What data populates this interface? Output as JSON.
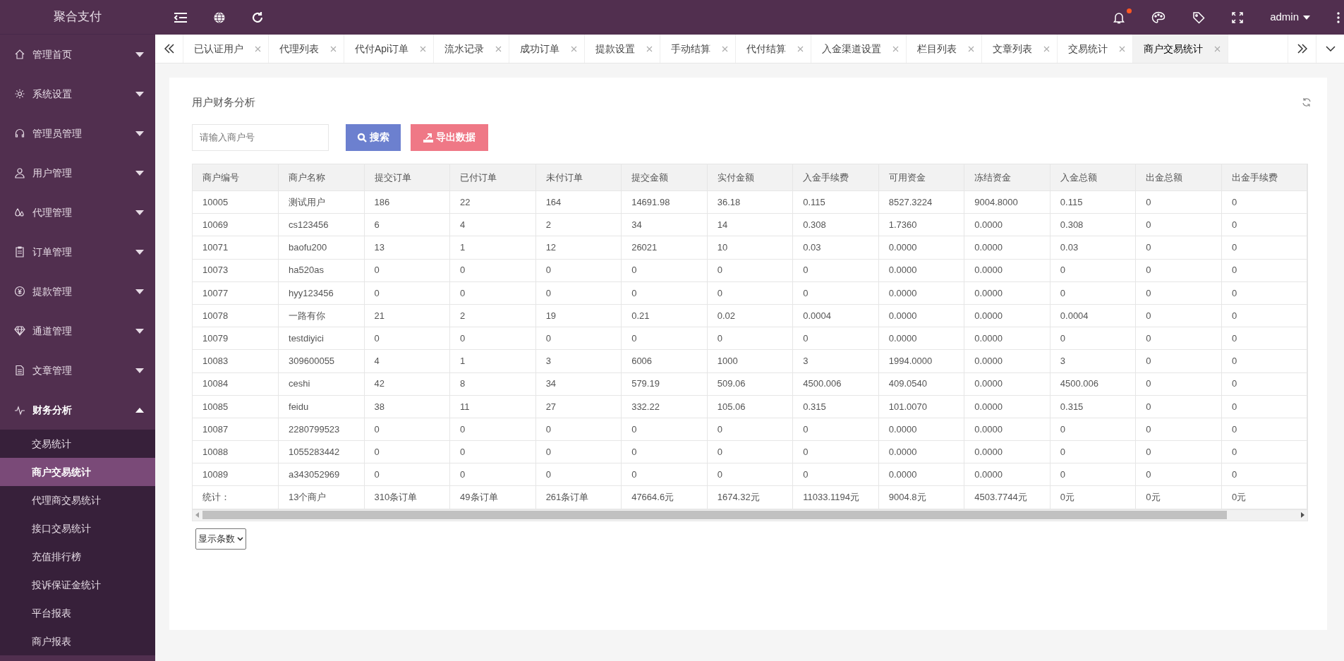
{
  "logo": "聚合支付",
  "user_menu": {
    "label": "admin"
  },
  "notification": {
    "unread": true
  },
  "tabs": [
    {
      "label": "已认证用户",
      "selected": false
    },
    {
      "label": "代理列表",
      "selected": false
    },
    {
      "label": "代付Api订单",
      "selected": false
    },
    {
      "label": "流水记录",
      "selected": false
    },
    {
      "label": "成功订单",
      "selected": false
    },
    {
      "label": "提款设置",
      "selected": false
    },
    {
      "label": "手动结算",
      "selected": false
    },
    {
      "label": "代付结算",
      "selected": false
    },
    {
      "label": "入金渠道设置",
      "selected": false
    },
    {
      "label": "栏目列表",
      "selected": false
    },
    {
      "label": "文章列表",
      "selected": false
    },
    {
      "label": "交易统计",
      "selected": false
    },
    {
      "label": "商户交易统计",
      "selected": true
    }
  ],
  "sidebar": {
    "items": [
      {
        "label": "管理首页",
        "expanded": false
      },
      {
        "label": "系统设置",
        "expanded": false
      },
      {
        "label": "管理员管理",
        "expanded": false
      },
      {
        "label": "用户管理",
        "expanded": false
      },
      {
        "label": "代理管理",
        "expanded": false
      },
      {
        "label": "订单管理",
        "expanded": false
      },
      {
        "label": "提款管理",
        "expanded": false
      },
      {
        "label": "通道管理",
        "expanded": false
      },
      {
        "label": "文章管理",
        "expanded": false
      },
      {
        "label": "财务分析",
        "expanded": true,
        "children": [
          {
            "label": "交易统计",
            "selected": false
          },
          {
            "label": "商户交易统计",
            "selected": true
          },
          {
            "label": "代理商交易统计",
            "selected": false
          },
          {
            "label": "接口交易统计",
            "selected": false
          },
          {
            "label": "充值排行榜",
            "selected": false
          },
          {
            "label": "投诉保证金统计",
            "selected": false
          },
          {
            "label": "平台报表",
            "selected": false
          },
          {
            "label": "商户报表",
            "selected": false
          }
        ]
      }
    ]
  },
  "panel": {
    "title": "用户财务分析",
    "search": {
      "placeholder": "请输入商户号"
    },
    "buttons": [
      {
        "kind": "search",
        "label": "搜索"
      },
      {
        "kind": "export",
        "label": "导出数据"
      }
    ],
    "table": {
      "columns": [
        "商户编号",
        "商户名称",
        "提交订单",
        "已付订单",
        "未付订单",
        "提交金额",
        "实付金额",
        "入金手续费",
        "可用资金",
        "冻结资金",
        "入金总额",
        "出金总额",
        "出金手续费"
      ],
      "rows": [
        [
          "10005",
          "测试用户",
          "186",
          "22",
          "164",
          "14691.98",
          "36.18",
          "0.115",
          "8527.3224",
          "9004.8000",
          "0.115",
          "0",
          "0"
        ],
        [
          "10069",
          "cs123456",
          "6",
          "4",
          "2",
          "34",
          "14",
          "0.308",
          "1.7360",
          "0.0000",
          "0.308",
          "0",
          "0"
        ],
        [
          "10071",
          "baofu200",
          "13",
          "1",
          "12",
          "26021",
          "10",
          "0.03",
          "0.0000",
          "0.0000",
          "0.03",
          "0",
          "0"
        ],
        [
          "10073",
          "ha520as",
          "0",
          "0",
          "0",
          "0",
          "0",
          "0",
          "0.0000",
          "0.0000",
          "0",
          "0",
          "0"
        ],
        [
          "10077",
          "hyy123456",
          "0",
          "0",
          "0",
          "0",
          "0",
          "0",
          "0.0000",
          "0.0000",
          "0",
          "0",
          "0"
        ],
        [
          "10078",
          "一路有你",
          "21",
          "2",
          "19",
          "0.21",
          "0.02",
          "0.0004",
          "0.0000",
          "0.0000",
          "0.0004",
          "0",
          "0"
        ],
        [
          "10079",
          "testdiyici",
          "0",
          "0",
          "0",
          "0",
          "0",
          "0",
          "0.0000",
          "0.0000",
          "0",
          "0",
          "0"
        ],
        [
          "10083",
          "309600055",
          "4",
          "1",
          "3",
          "6006",
          "1000",
          "3",
          "1994.0000",
          "0.0000",
          "3",
          "0",
          "0"
        ],
        [
          "10084",
          "ceshi",
          "42",
          "8",
          "34",
          "579.19",
          "509.06",
          "4500.006",
          "409.0540",
          "0.0000",
          "4500.006",
          "0",
          "0"
        ],
        [
          "10085",
          "feidu",
          "38",
          "11",
          "27",
          "332.22",
          "105.06",
          "0.315",
          "101.0070",
          "0.0000",
          "0.315",
          "0",
          "0"
        ],
        [
          "10087",
          "2280799523",
          "0",
          "0",
          "0",
          "0",
          "0",
          "0",
          "0.0000",
          "0.0000",
          "0",
          "0",
          "0"
        ],
        [
          "10088",
          "1055283442",
          "0",
          "0",
          "0",
          "0",
          "0",
          "0",
          "0.0000",
          "0.0000",
          "0",
          "0",
          "0"
        ],
        [
          "10089",
          "a343052969",
          "0",
          "0",
          "0",
          "0",
          "0",
          "0",
          "0.0000",
          "0.0000",
          "0",
          "0",
          "0"
        ]
      ],
      "totals": [
        "统计：",
        "13个商户",
        "310条订单",
        "49条订单",
        "261条订单",
        "47664.6元",
        "1674.32元",
        "11033.1194元",
        "9004.8元",
        "4503.7744元",
        "0元",
        "0元",
        "0元"
      ]
    },
    "page_size": {
      "label": "显示条数"
    }
  }
}
